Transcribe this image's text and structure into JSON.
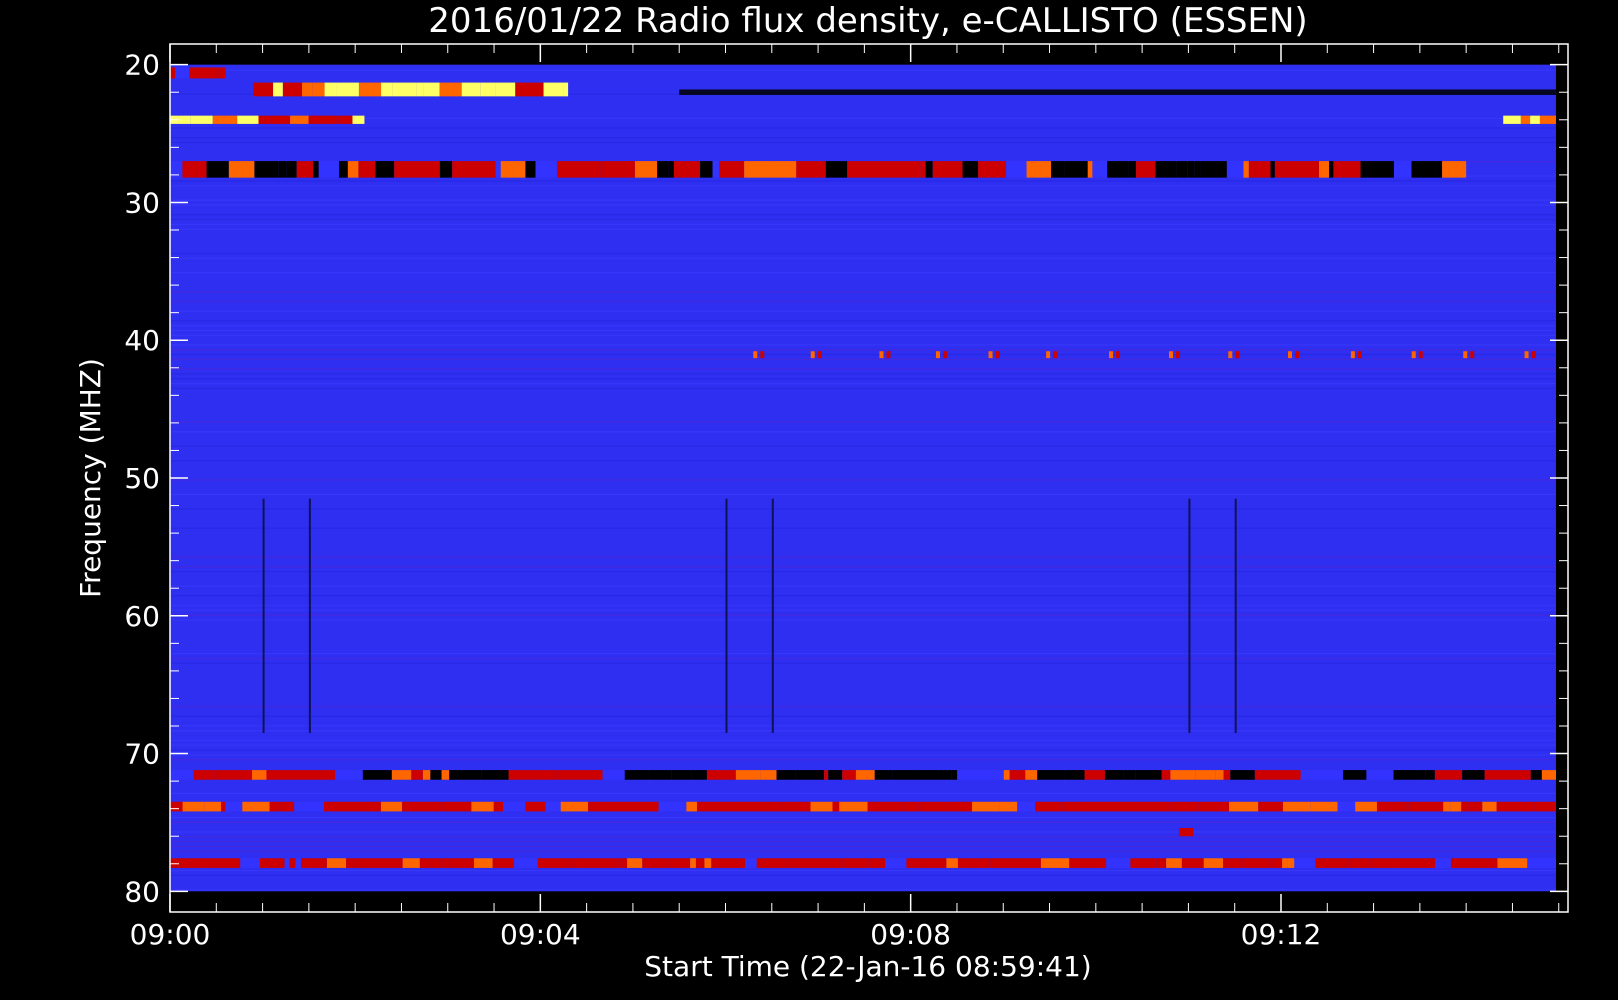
{
  "chart_data": {
    "type": "heatmap",
    "title": "2016/01/22  Radio flux density, e-CALLISTO (ESSEN)",
    "xlabel": "Start Time (22-Jan-16 08:59:41)",
    "ylabel": "Frequency (MHZ)",
    "x_range_minutes": [
      0,
      15.1
    ],
    "y_range_mhz": [
      18.5,
      81.5
    ],
    "y_inverted": true,
    "data_extent_minutes": [
      0,
      14.97
    ],
    "data_extent_mhz": [
      20,
      80
    ],
    "x_ticks": [
      {
        "label": "09:00",
        "minute": 0
      },
      {
        "label": "09:04",
        "minute": 4
      },
      {
        "label": "09:08",
        "minute": 8
      },
      {
        "label": "09:12",
        "minute": 12
      }
    ],
    "y_ticks": [
      {
        "label": "20",
        "mhz": 20
      },
      {
        "label": "30",
        "mhz": 30
      },
      {
        "label": "40",
        "mhz": 40
      },
      {
        "label": "50",
        "mhz": 50
      },
      {
        "label": "60",
        "mhz": 60
      },
      {
        "label": "70",
        "mhz": 70
      },
      {
        "label": "80",
        "mhz": 80
      }
    ],
    "colormap": [
      "#000000",
      "#1a1acc",
      "#3333ff",
      "#cc0000",
      "#ff6600",
      "#ffff66"
    ],
    "background_color": "#2f2ff2",
    "features": [
      {
        "name": "bright interference band",
        "f_mhz": [
          21.3,
          22.3
        ],
        "t_min": [
          0.9,
          4.3
        ],
        "level": "yellow"
      },
      {
        "name": "band near 20.6 MHz",
        "f_mhz": [
          20.2,
          21.0
        ],
        "t_min": [
          0,
          0.6
        ],
        "level": "red"
      },
      {
        "name": "band near 24 MHz",
        "f_mhz": [
          23.7,
          24.3
        ],
        "t_min": [
          0,
          2.1
        ],
        "level": "orange"
      },
      {
        "name": "band near 24 MHz end",
        "f_mhz": [
          23.7,
          24.3
        ],
        "t_min": [
          14.4,
          14.97
        ],
        "level": "orange"
      },
      {
        "name": "dark band near 22 MHz",
        "f_mhz": [
          21.8,
          22.2
        ],
        "t_min": [
          5.5,
          14.97
        ],
        "level": "black"
      },
      {
        "name": "band near 27.5 MHz",
        "f_mhz": [
          27.0,
          28.2
        ],
        "t_min": [
          0,
          14.0
        ],
        "level": "mixed"
      },
      {
        "name": "dots near 41 MHz",
        "f_mhz": [
          40.8,
          41.3
        ],
        "t_min": [
          6.3,
          14.97
        ],
        "level": "orange"
      },
      {
        "name": "band near 71.5 MHz",
        "f_mhz": [
          71.2,
          71.9
        ],
        "t_min": [
          0,
          14.97
        ],
        "level": "mixed"
      },
      {
        "name": "band near 73.8 MHz",
        "f_mhz": [
          73.5,
          74.2
        ],
        "t_min": [
          0,
          14.97
        ],
        "level": "red"
      },
      {
        "name": "band near 78 MHz",
        "f_mhz": [
          77.6,
          78.3
        ],
        "t_min": [
          0,
          14.97
        ],
        "level": "red"
      },
      {
        "name": "spot near 75.6 MHz",
        "f_mhz": [
          75.4,
          76.0
        ],
        "t_min": [
          10.9,
          11.05
        ],
        "level": "yellow"
      }
    ],
    "vertical_dark_lines_minutes": [
      1.0,
      1.5,
      6.0,
      6.5,
      11.0,
      11.5
    ],
    "vertical_dark_lines_mhz": [
      51.5,
      68.5
    ]
  }
}
